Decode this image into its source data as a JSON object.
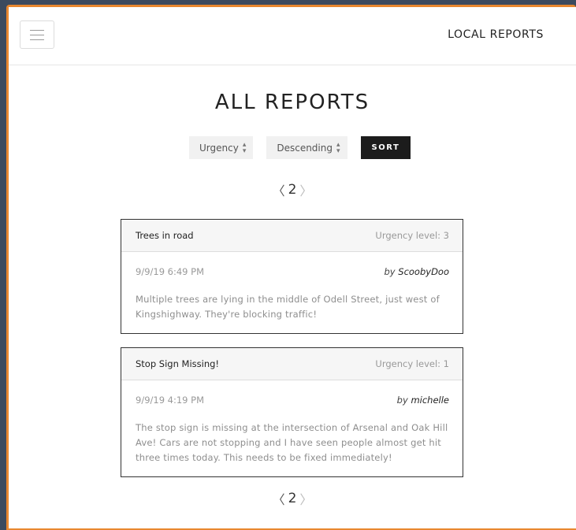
{
  "navbar": {
    "menu_icon": "hamburger-menu-icon",
    "brand": "LOCAL REPORTS"
  },
  "main": {
    "title": "ALL REPORTS",
    "controls": {
      "sort_field": "Urgency",
      "sort_order": "Descending",
      "sort_button": "SORT"
    },
    "pagination": {
      "prev_icon": "chevron-left-icon",
      "next_icon": "chevron-right-icon",
      "current_page": "2"
    },
    "reports": [
      {
        "title": "Trees in road",
        "urgency": "Urgency level: 3",
        "timestamp": "9/9/19 6:49 PM",
        "by": "by",
        "author": "ScoobyDoo",
        "description": "Multiple trees are lying in the middle of Odell Street, just west of Kingshighway. They're blocking traffic!"
      },
      {
        "title": "Stop Sign Missing!",
        "urgency": "Urgency level: 1",
        "timestamp": "9/9/19 4:19 PM",
        "by": "by",
        "author": "michelle",
        "description": "The stop sign is missing at the intersection of Arsenal and Oak Hill Ave! Cars are not stopping and I have seen people almost get hit three times today. This needs to be fixed immediately!"
      }
    ]
  },
  "colors": {
    "frame_accent": "#e8872f",
    "sort_button_bg": "#1c1c1c",
    "card_border": "#333333"
  }
}
